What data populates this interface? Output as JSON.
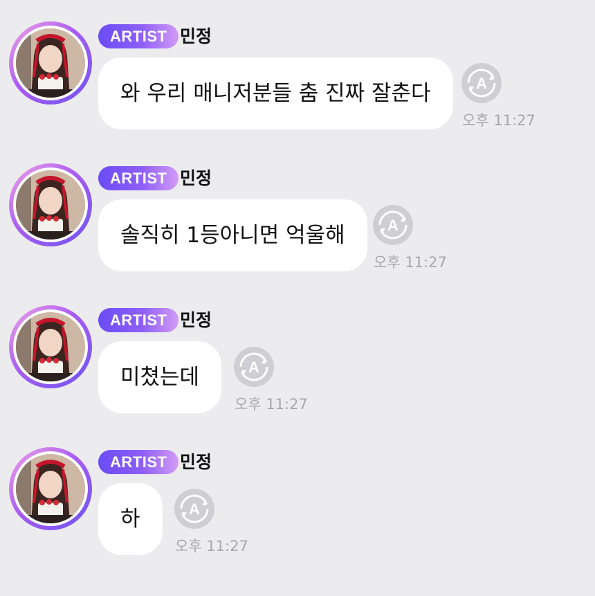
{
  "messages": [
    {
      "badge": "ARTIST",
      "name": "민정",
      "text": "와 우리 매니저분들 춤 진짜 잘춘다",
      "time": "오후 11:27",
      "translate_icon": "auto-translate-icon"
    },
    {
      "badge": "ARTIST",
      "name": "민정",
      "text": "솔직히 1등아니면 억울해",
      "time": "오후 11:27",
      "translate_icon": "auto-translate-icon"
    },
    {
      "badge": "ARTIST",
      "name": "민정",
      "text": "미쳤는데",
      "time": "오후 11:27",
      "translate_icon": "auto-translate-icon"
    },
    {
      "badge": "ARTIST",
      "name": "민정",
      "text": "하",
      "time": "오후 11:27",
      "translate_icon": "auto-translate-icon"
    }
  ],
  "colors": {
    "background": "#ececef",
    "bubble": "#ffffff",
    "badge_start": "#6b4cf6",
    "badge_end": "#d49bf5",
    "avatar_ring": "#a95cf0",
    "time_text": "#a6a6ab",
    "translate_button": "#cfcfd3"
  }
}
